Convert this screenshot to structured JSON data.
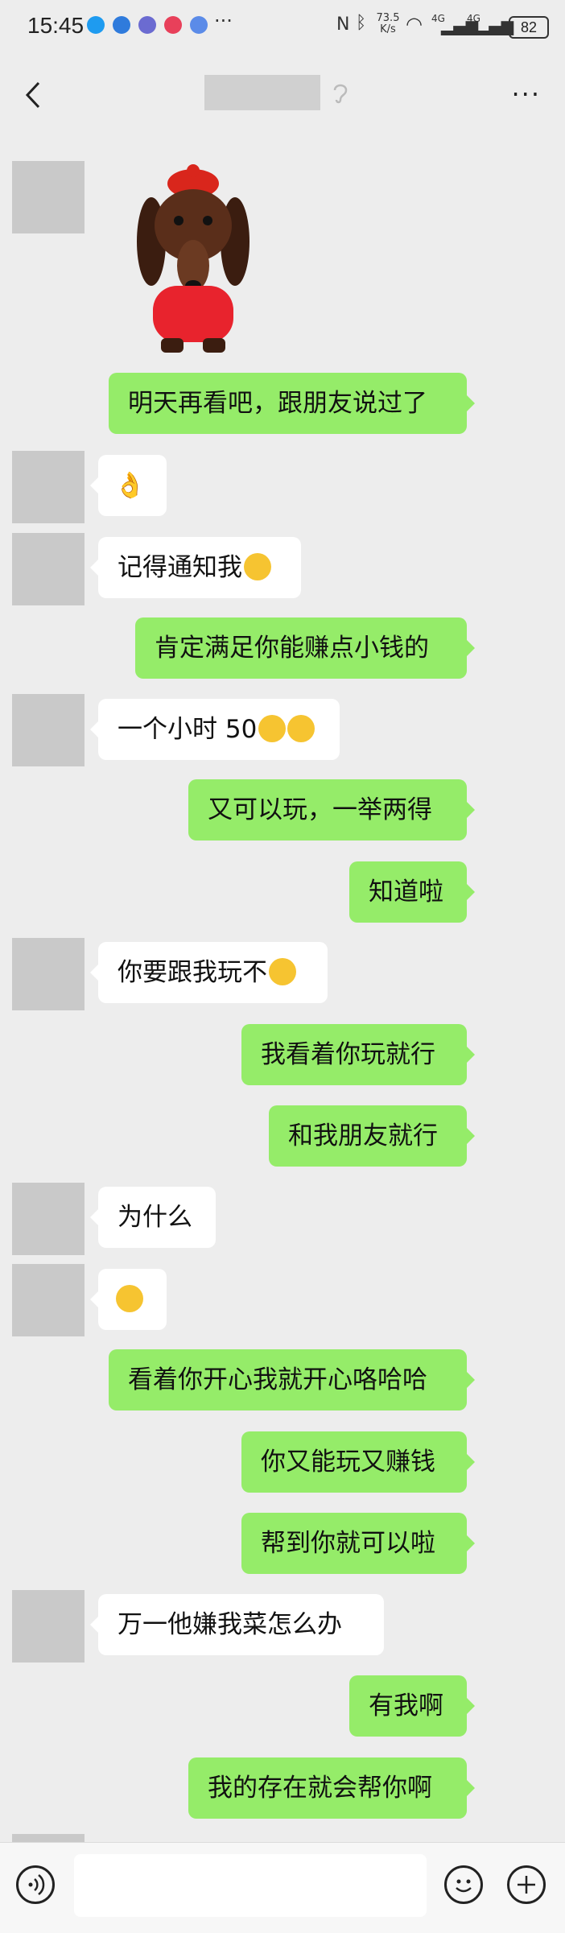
{
  "status_bar": {
    "time": "15:45",
    "network_speed": "73.5 K/s",
    "signal_1": "4G",
    "signal_2": "4G",
    "battery": "82"
  },
  "nav": {
    "back_icon": "chevron-left-icon",
    "more_label": "···"
  },
  "messages": [
    {
      "side": "in",
      "type": "sticker",
      "sticker": "dachshund-in-red-jacket-sticker"
    },
    {
      "side": "out",
      "text": "明天再看吧，跟朋友说过了"
    },
    {
      "side": "in",
      "text": "👌"
    },
    {
      "side": "in",
      "text": "记得通知我",
      "emoji": "smile-emoji"
    },
    {
      "side": "out",
      "text": "肯定满足你能赚点小钱的"
    },
    {
      "side": "in",
      "text": "一个小时 50",
      "emoji": "flushed-emoji x2"
    },
    {
      "side": "out",
      "text": "又可以玩，一举两得"
    },
    {
      "side": "out",
      "text": "知道啦"
    },
    {
      "side": "in",
      "text": "你要跟我玩不",
      "emoji": "grin-emoji"
    },
    {
      "side": "out",
      "text": "我看着你玩就行"
    },
    {
      "side": "out",
      "text": "和我朋友就行"
    },
    {
      "side": "in",
      "text": "为什么"
    },
    {
      "side": "in",
      "text": "",
      "emoji": "hand-over-mouth-emoji"
    },
    {
      "side": "out",
      "text": "看着你开心我就开心咯哈哈"
    },
    {
      "side": "out",
      "text": "你又能玩又赚钱"
    },
    {
      "side": "out",
      "text": "帮到你就可以啦"
    },
    {
      "side": "in",
      "text": "万一他嫌我菜怎么办"
    },
    {
      "side": "out",
      "text": "有我啊"
    },
    {
      "side": "out",
      "text": "我的存在就会帮你啊"
    }
  ],
  "bottom_bar": {
    "voice_icon": "voice-icon",
    "emoji_icon": "emoji-icon",
    "plus_icon": "plus-icon"
  }
}
